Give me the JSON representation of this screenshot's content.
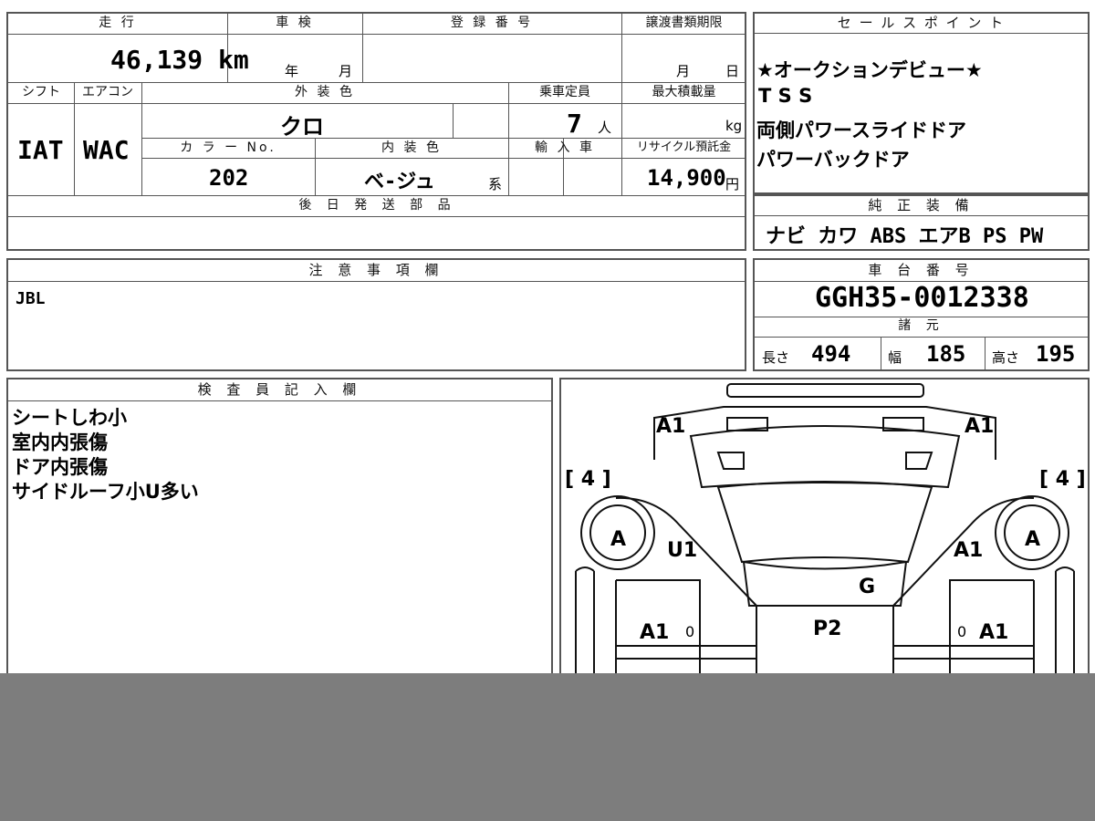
{
  "top_left": {
    "header_mileage": "走 行",
    "header_shaken": "車 検",
    "header_reg": "登 録 番 号",
    "header_transfer": "譲渡書類期限",
    "mileage": "46,139 km",
    "year_unit": "年",
    "month_unit": "月",
    "transfer_month": "月",
    "transfer_day": "日",
    "header_shift": "シフト",
    "header_ac": "エアコン",
    "header_ext_color": "外 装 色",
    "header_capacity": "乗車定員",
    "header_max_load": "最大積載量",
    "shift": "IAT",
    "ac": "WAC",
    "ext_color": "クロ",
    "capacity": "7",
    "capacity_unit": "人",
    "load_unit": "kg",
    "header_color_no": "カ ラ ー No.",
    "header_int_color": "内 装 色",
    "header_import": "輸 入 車",
    "header_recycle": "リサイクル預託金",
    "color_no": "202",
    "int_color": "ベ-ジュ",
    "int_color_suffix": "系",
    "recycle": "14,900",
    "recycle_unit": "円",
    "header_later_parts": "後 日 発 送 部 品"
  },
  "sales_points": {
    "header": "セ ー ル ス ポ イ ン ト",
    "lines": [
      "★オークションデビュー★",
      "T S S",
      "両側パワースライドドア",
      "パワーバックドア"
    ]
  },
  "equipment": {
    "header": "純 正 装 備",
    "value": "ナビ カワ ABS エアB PS PW"
  },
  "notes": {
    "header": "注 意 事 項 欄",
    "value": "JBL"
  },
  "chassis": {
    "header": "車 台 番 号",
    "value": "GGH35-0012338",
    "spec_header": "諸 元",
    "length_label": "長さ",
    "length": "494",
    "width_label": "幅",
    "width": "185",
    "height_label": "高さ",
    "height": "195"
  },
  "inspector": {
    "header": "検 査 員 記 入 欄",
    "lines": [
      "シートしわ小",
      "室内内張傷",
      "ドア内張傷",
      "サイドルーフ小U多い"
    ]
  },
  "diagram": {
    "marks": {
      "a1_front_left": "A1",
      "a1_front_right": "A1",
      "bracket_left": "[ 4 ]",
      "bracket_right": "[ 4 ]",
      "wheel_left": "A",
      "wheel_right": "A",
      "u1": "U1",
      "a1_mid_right": "A1",
      "g": "G",
      "a1_door_left": "A1",
      "a1_door_right": "A1",
      "p2": "P2",
      "zero_left": "0",
      "zero_right": "0"
    }
  }
}
